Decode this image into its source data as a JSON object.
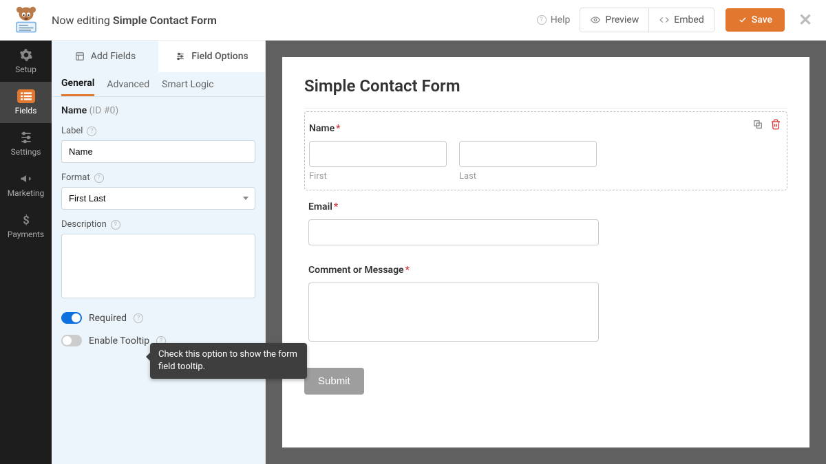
{
  "header": {
    "editing_prefix": "Now editing ",
    "form_name": "Simple Contact Form",
    "help": "Help",
    "preview": "Preview",
    "embed": "Embed",
    "save": "Save"
  },
  "sidenav": {
    "setup": "Setup",
    "fields": "Fields",
    "settings": "Settings",
    "marketing": "Marketing",
    "payments": "Payments"
  },
  "panel": {
    "tab_add": "Add Fields",
    "tab_opts": "Field Options",
    "sub_general": "General",
    "sub_advanced": "Advanced",
    "sub_smart": "Smart Logic",
    "field_name": "Name",
    "field_id": "(ID #0)",
    "label_label": "Label",
    "label_value": "Name",
    "format_label": "Format",
    "format_value": "First Last",
    "desc_label": "Description",
    "required_label": "Required",
    "tooltip_label": "Enable Tooltip",
    "tooltip_text": "Check this option to show the form field tooltip."
  },
  "preview": {
    "title": "Simple Contact Form",
    "name_label": "Name",
    "first": "First",
    "last": "Last",
    "email_label": "Email",
    "comment_label": "Comment or Message",
    "submit": "Submit"
  }
}
